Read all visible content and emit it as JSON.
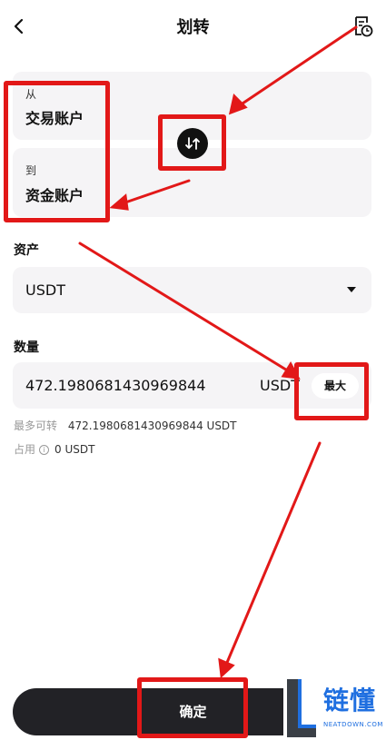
{
  "header": {
    "title": "划转",
    "back_icon": "chevron-left-icon",
    "history_icon": "history-icon"
  },
  "from": {
    "label": "从",
    "account": "交易账户"
  },
  "to": {
    "label": "到",
    "account": "资金账户"
  },
  "swap_icon": "swap-arrows-icon",
  "asset": {
    "label": "资产",
    "value": "USDT"
  },
  "amount": {
    "label": "数量",
    "value": "472.1980681430969844",
    "unit": "USDT",
    "max_label": "最大"
  },
  "info": {
    "max_transferable_label": "最多可转",
    "max_transferable_value": "472.1980681430969844 USDT",
    "occupied_label": "占用",
    "occupied_value": "0 USDT"
  },
  "confirm_label": "确定",
  "watermark": {
    "name": "链懂",
    "sub": "NEATDOWN.COM"
  },
  "colors": {
    "accent": "#222226",
    "annotation": "#e21818",
    "card": "#f5f4f6",
    "brand": "#1f6fe0"
  }
}
